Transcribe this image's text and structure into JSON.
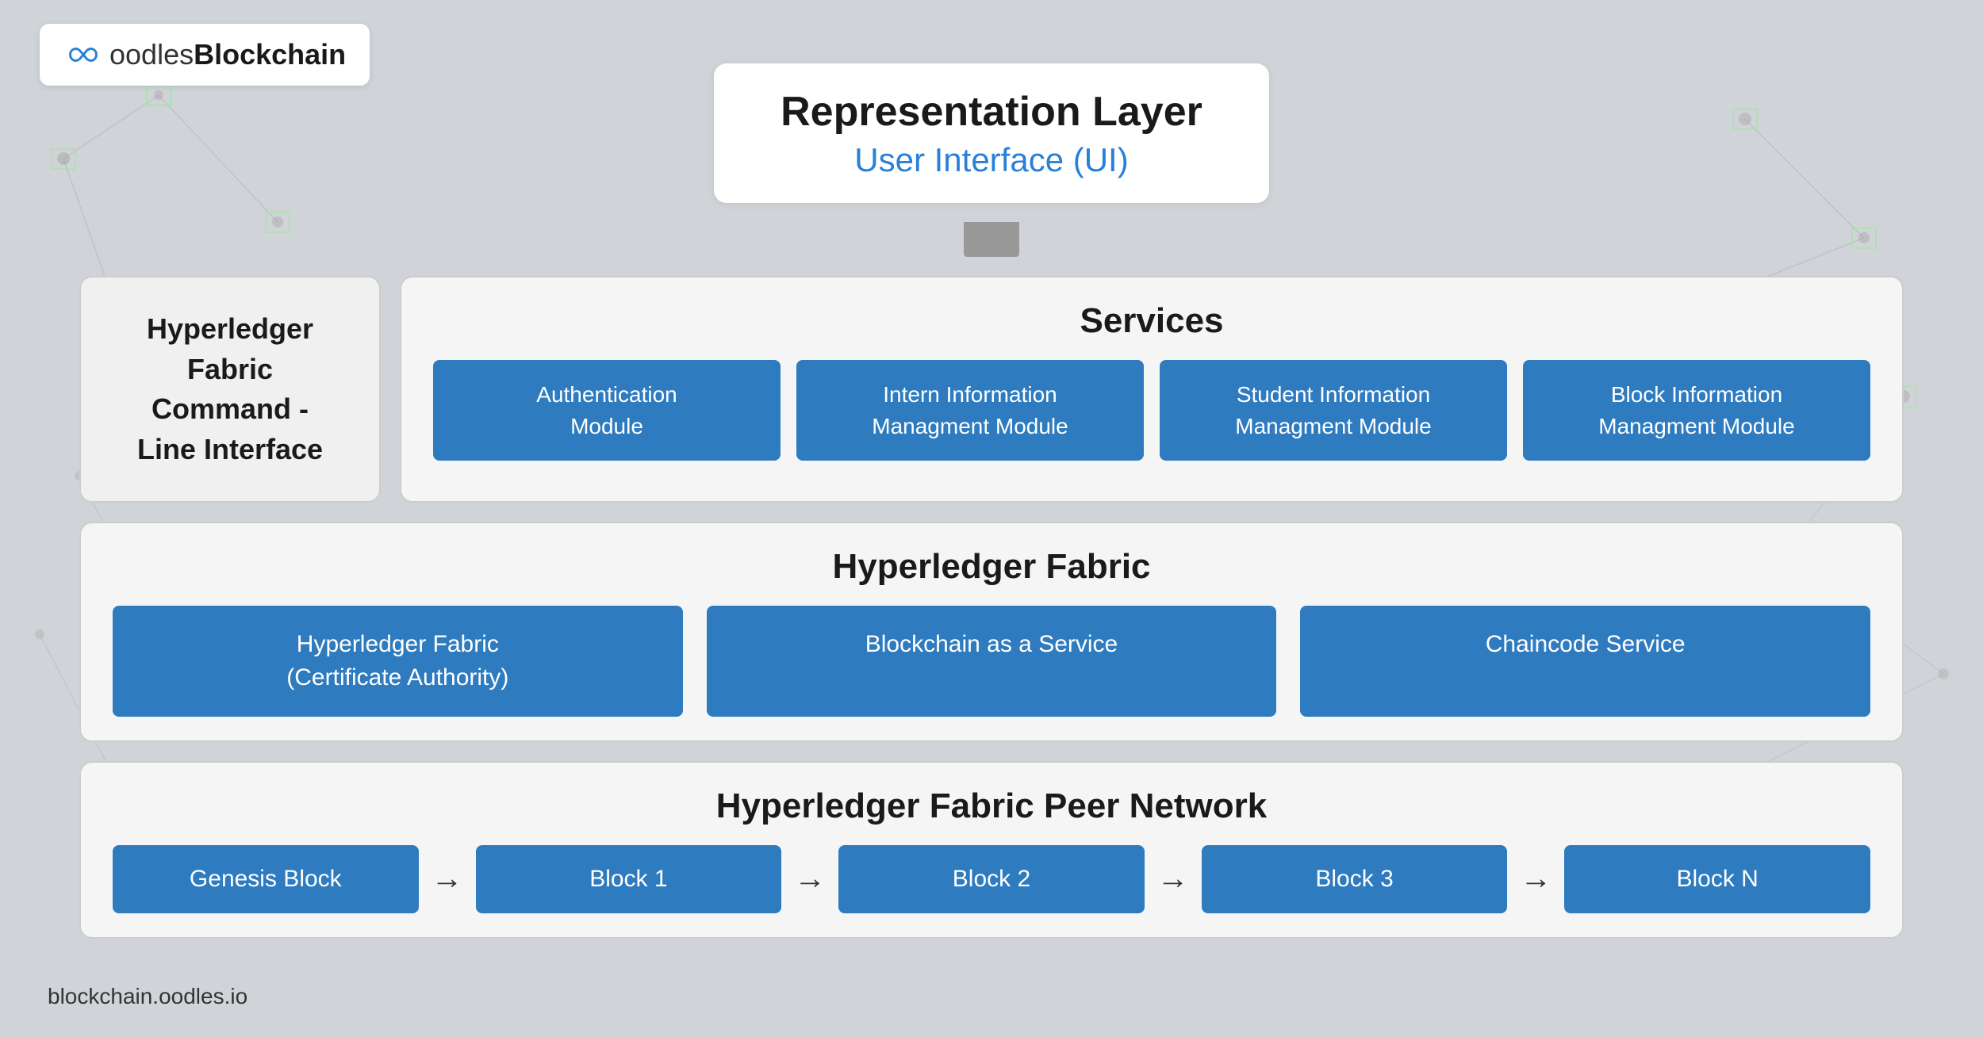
{
  "logo": {
    "text_plain": "oodles",
    "text_bold": "Blockchain",
    "bottom_link": "blockchain.oodles.io"
  },
  "rep_layer": {
    "title": "Representation Layer",
    "subtitle": "User Interface (UI)"
  },
  "cli": {
    "text": "Hyperledger Fabric Command - Line Interface"
  },
  "services": {
    "title": "Services",
    "modules": [
      {
        "label": "Authentication\nModule"
      },
      {
        "label": "Intern Information\nManagment Module"
      },
      {
        "label": "Student Information\nManagment Module"
      },
      {
        "label": "Block Information\nManagment Module"
      }
    ]
  },
  "hyperledger_fabric": {
    "title": "Hyperledger Fabric",
    "modules": [
      {
        "label": "Hyperledger Fabric\n(Certificate Authority)"
      },
      {
        "label": "Blockchain as a Service"
      },
      {
        "label": "Chaincode Service"
      }
    ]
  },
  "peer_network": {
    "title": "Hyperledger Fabric Peer Network",
    "blocks": [
      {
        "label": "Genesis Block"
      },
      {
        "label": "Block 1"
      },
      {
        "label": "Block 2"
      },
      {
        "label": "Block 3"
      },
      {
        "label": "Block N"
      }
    ]
  }
}
